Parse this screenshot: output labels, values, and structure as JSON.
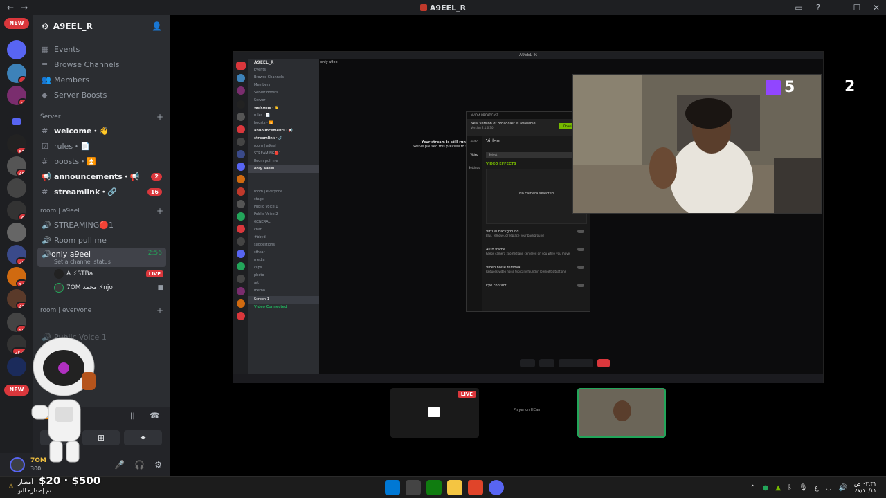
{
  "window": {
    "title": "A9EEL_R",
    "nav_back": "←",
    "nav_forward": "→"
  },
  "rail": {
    "new_top": "NEW",
    "new_bottom": "NEW",
    "badges": [
      "7",
      "8",
      "82",
      "45",
      "6",
      "20",
      "34",
      "49",
      "50",
      "2K+"
    ]
  },
  "server": {
    "name": "A9EEL_R",
    "items": [
      {
        "label": "Events"
      },
      {
        "label": "Browse Channels"
      },
      {
        "label": "Members"
      },
      {
        "label": "Server Boosts"
      }
    ]
  },
  "categories": {
    "server": "Server",
    "room_a9eel": "room | a9eel",
    "room_everyone": "room | everyone"
  },
  "channels": {
    "welcome": "welcome・👋",
    "rules": "rules・📄",
    "boosts": "boosts・⏫",
    "announcements": "announcements・📢",
    "announcements_count": "2",
    "streamlink": "streamlink・🔗",
    "streamlink_count": "16",
    "streaming": "STREAMING🔴1",
    "room_pull_me": "Room pull me",
    "only_a9eel": "only a9eel",
    "only_a9eel_time": "2:56",
    "channel_status": "Set a channel status",
    "user1_name": "A  ⚡STBa",
    "user1_live": "LIVE",
    "user2_name": "7OM محمد ⚡njo",
    "public_voice": "Public Voice 1"
  },
  "user_area": {
    "name": "7OM",
    "sub": "300"
  },
  "stream": {
    "title": "A9EEL_R",
    "channel": "only a9eel",
    "running_bold": "Your stream is still running",
    "running_sub": "We've paused this preview to save your",
    "sidebar_rows": [
      "A9EEL_R",
      "Events",
      "Browse Channels",
      "Members",
      "Server Boosts",
      "Server",
      "welcome・👋",
      "rules・📄",
      "boosts・⏫",
      "announcements・📢",
      "streamlink・🔗",
      "room | a9eel",
      "STREAMING🔴1",
      "Room pull me",
      "only a9eel",
      "",
      "",
      "room | everyone",
      "stage",
      "Public Voice 1",
      "Public Voice 2",
      "GENERAL",
      "chat",
      "#bbyd",
      "suggestions",
      "sthkar",
      "media",
      "clips",
      "photo",
      "art",
      "memo"
    ],
    "screen_label": "Screen 1",
    "video_connected": "Video Connected"
  },
  "nvidia": {
    "header": "NVIDIA BROADCAST",
    "update_title": "New version of Broadcast is available",
    "update_version": "Version 2.1.0.30",
    "download": "Download",
    "section": "Video",
    "select": "Select",
    "effects": "VIDEO EFFECTS",
    "no_camera": "No camera selected",
    "options": [
      {
        "title": "Virtual background",
        "desc": "Blur, remove, or replace your background"
      },
      {
        "title": "Auto frame",
        "desc": "Keeps camera zoomed and centered on you while you move"
      },
      {
        "title": "Video noise removal",
        "desc": "Reduces video noise typically found in low light situations"
      },
      {
        "title": "Eye contact",
        "desc": ""
      }
    ],
    "left_labels": [
      "Audio",
      "Video",
      "Settings"
    ]
  },
  "webcam": {
    "score_twitch": "5",
    "score_kick": "2"
  },
  "thumbnails": {
    "live": "LIVE",
    "mini_text": "Player on HCam"
  },
  "taskbar": {
    "weather_ar": "أمطار",
    "weather_sub": "تم إصداره للتو",
    "promo": "$20 · $500",
    "lang": "ع",
    "time": "٠٣:٣١ ص",
    "date": "٤٧/١٠/١١"
  },
  "colors": {
    "discord_bg": "#2b2d31",
    "rail_bg": "#1e1f22",
    "live_red": "#da373c",
    "speaking_green": "#23a55a",
    "nvidia_green": "#76b900",
    "twitch_purple": "#9146ff",
    "kick_green": "#53fc18"
  }
}
